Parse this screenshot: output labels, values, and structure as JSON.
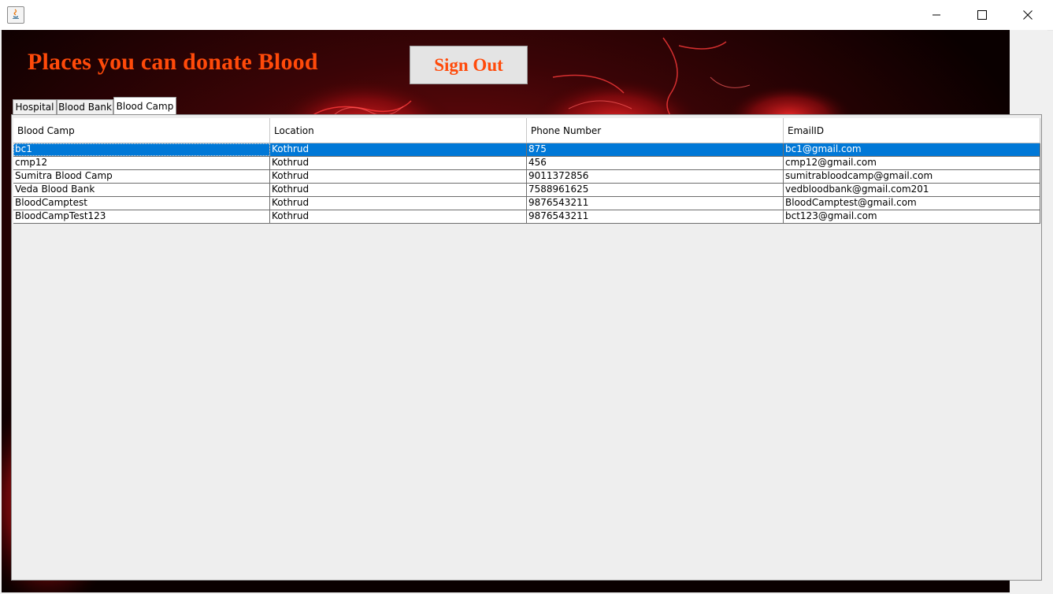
{
  "window": {
    "icon": "java-icon",
    "controls": [
      "minimize-icon",
      "maximize-icon",
      "close-icon"
    ]
  },
  "header": {
    "title": "Places you can donate Blood",
    "sign_out_label": "Sign Out"
  },
  "tabs": [
    {
      "label": "Hospital",
      "active": false
    },
    {
      "label": "Blood Bank",
      "active": false
    },
    {
      "label": "Blood Camp",
      "active": true
    }
  ],
  "table": {
    "columns": [
      "Blood Camp",
      "Location",
      "Phone Number",
      "EmailID"
    ],
    "selected_row": 0,
    "rows": [
      [
        "bc1",
        "Kothrud",
        "875",
        "bc1@gmail.com"
      ],
      [
        "cmp12",
        "Kothrud",
        "456",
        "cmp12@gmail.com"
      ],
      [
        "Sumitra Blood Camp",
        "Kothrud",
        "9011372856",
        "sumitrabloodcamp@gmail.com"
      ],
      [
        "Veda Blood Bank",
        "Kothrud",
        "7588961625",
        "vedbloodbank@gmail.com201"
      ],
      [
        "BloodCamptest",
        "Kothrud",
        "9876543211",
        "BloodCamptest@gmail.com"
      ],
      [
        "BloodCampTest123",
        "Kothrud",
        "9876543211",
        "bct123@gmail.com"
      ]
    ]
  },
  "colors": {
    "accent": "#ff4a0a",
    "selection": "#0078d7"
  }
}
